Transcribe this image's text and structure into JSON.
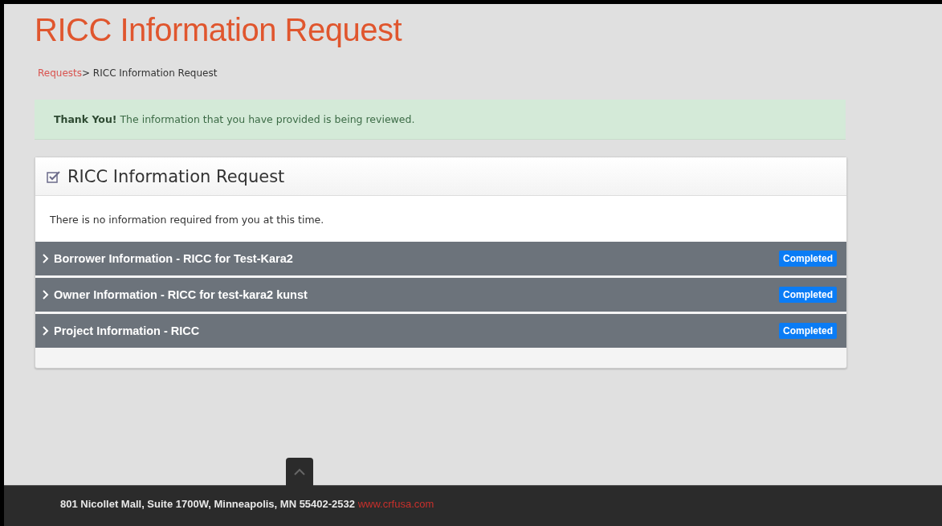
{
  "page": {
    "title": "RICC Information Request"
  },
  "breadcrumb": [
    {
      "label": "Requests",
      "link": true
    },
    {
      "label": "> RICC Information Request",
      "link": false
    }
  ],
  "alert": {
    "text": "**Thank You!** The information that you have provided is being reviewed."
  },
  "panel": {
    "title": "RICC Information Request",
    "message": "There is no information required from you at this time.",
    "sections": [
      {
        "label": "Borrower Information - RICC for Test-Kara2",
        "expanded": false,
        "status": "Completed"
      },
      {
        "label": "Owner Information - RICC for test-kara2 kunst",
        "expanded": false,
        "status": "Completed"
      },
      {
        "label": "Project Information - RICC",
        "expanded": false,
        "status": "Completed"
      }
    ]
  },
  "footer": {
    "address": "801 Nicollet Mall, Suite 1700W, Minneapolis, MN 55402-2532",
    "link": "www.crfusa.com"
  }
}
